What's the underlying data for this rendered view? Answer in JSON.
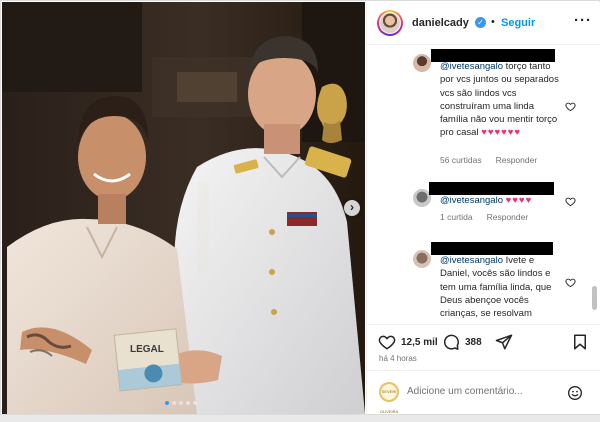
{
  "header": {
    "username": "danielcady",
    "verified_icon": "verified-badge-icon",
    "bullet": "•",
    "follow_label": "Seguir",
    "more_icon": "more-options-icon",
    "more_label": "···"
  },
  "photo": {
    "book_cover_text": "LEGAL",
    "next_icon": "chevron-right-icon",
    "next_label": "›",
    "carousel_total": 5,
    "carousel_active": 1
  },
  "comments": [
    {
      "mention": "@ivetesangalo",
      "text": " torço tanto por vcs juntos ou separados vcs são lindos vcs construíram uma linda família não vou mentir torço pro casal ",
      "hearts": "♥♥♥♥♥♥",
      "likes_label": "56 curtidas",
      "reply_label": "Responder"
    },
    {
      "mention": "@ivetesangalo",
      "text": " ",
      "hearts": "♥♥♥♥",
      "likes_label": "1 curtida",
      "reply_label": "Responder"
    },
    {
      "mention": "@ivetesangalo",
      "text": " Ivete e Daniel, vocês são lindos e tem uma família linda, que Deus abençoe vocês crianças, se resolvam",
      "hearts": "",
      "likes_label": "",
      "reply_label": ""
    }
  ],
  "actions": {
    "likes_count": "12,5 mil",
    "comments_count": "388",
    "like_icon": "heart-icon",
    "comment_icon": "comment-icon",
    "share_icon": "share-icon",
    "save_icon": "bookmark-icon"
  },
  "timestamp": "há 4 horas",
  "composer": {
    "placeholder": "Adicione um comentário...",
    "avatar_text": "SEVERI OLIVEIRA",
    "emoji_icon": "emoji-icon"
  },
  "colors": {
    "accent": "#0095f6",
    "verified": "#3897f0",
    "heart": "#ed2f6b",
    "mention": "#00376b",
    "meta": "#737373"
  }
}
